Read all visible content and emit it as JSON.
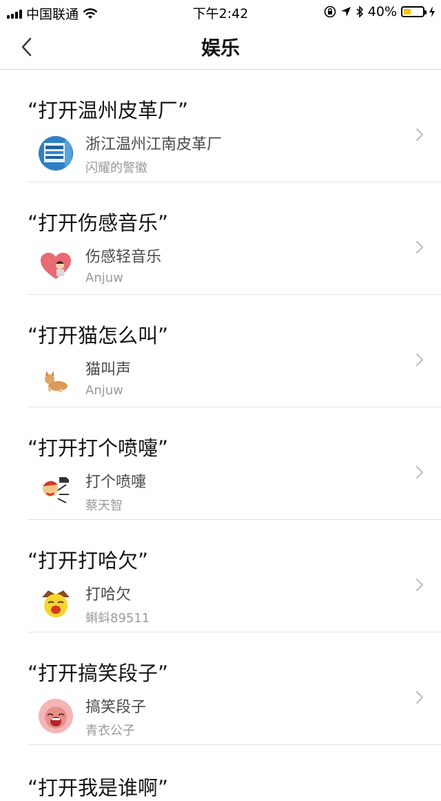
{
  "status_bar": {
    "carrier": "中国联通",
    "time": "下午2:42",
    "battery": "40%",
    "battery_level": 0.4,
    "icons": [
      "signal-icon",
      "wifi-icon",
      "orientation-lock-icon",
      "location-icon",
      "bluetooth-icon",
      "battery-icon",
      "charging-icon"
    ]
  },
  "nav": {
    "title": "娱乐",
    "back_icon": "chevron-left-icon"
  },
  "items": [
    {
      "command": "“打开温州皮革厂”",
      "skill": "浙江温州江南皮革厂",
      "author": "闪耀的警徽"
    },
    {
      "command": "“打开伤感音乐”",
      "skill": "伤感轻音乐",
      "author": "Anjuw"
    },
    {
      "command": "“打开猫怎么叫”",
      "skill": "猫叫声",
      "author": "Anjuw"
    },
    {
      "command": "“打开打个喷嚏”",
      "skill": "打个喷嚏",
      "author": "蔡天智"
    },
    {
      "command": "“打开打哈欠”",
      "skill": "打哈欠",
      "author": "蝌蚪89511"
    },
    {
      "command": "“打开搞笑段子”",
      "skill": "搞笑段子",
      "author": "青衣公子"
    }
  ],
  "partial_item": {
    "command": "“打开我是谁啊”"
  }
}
